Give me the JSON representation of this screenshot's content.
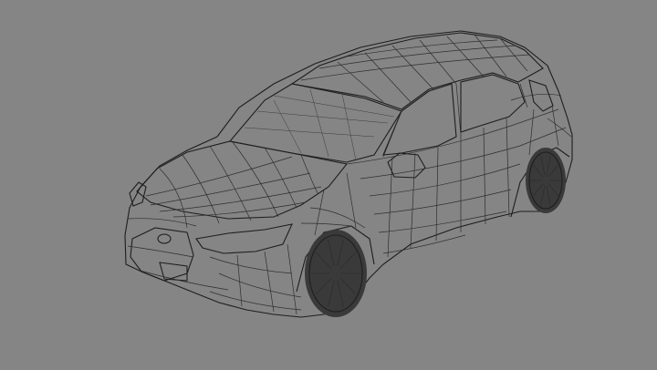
{
  "scene": {
    "background_color": "#858585",
    "model_fill_color": "#e3e6e4",
    "wire_color": "#2e2e2e",
    "subject": "hatchback-car-wireframe",
    "front_wheel_spokes": 10,
    "rear_wheel_spokes": 10
  }
}
